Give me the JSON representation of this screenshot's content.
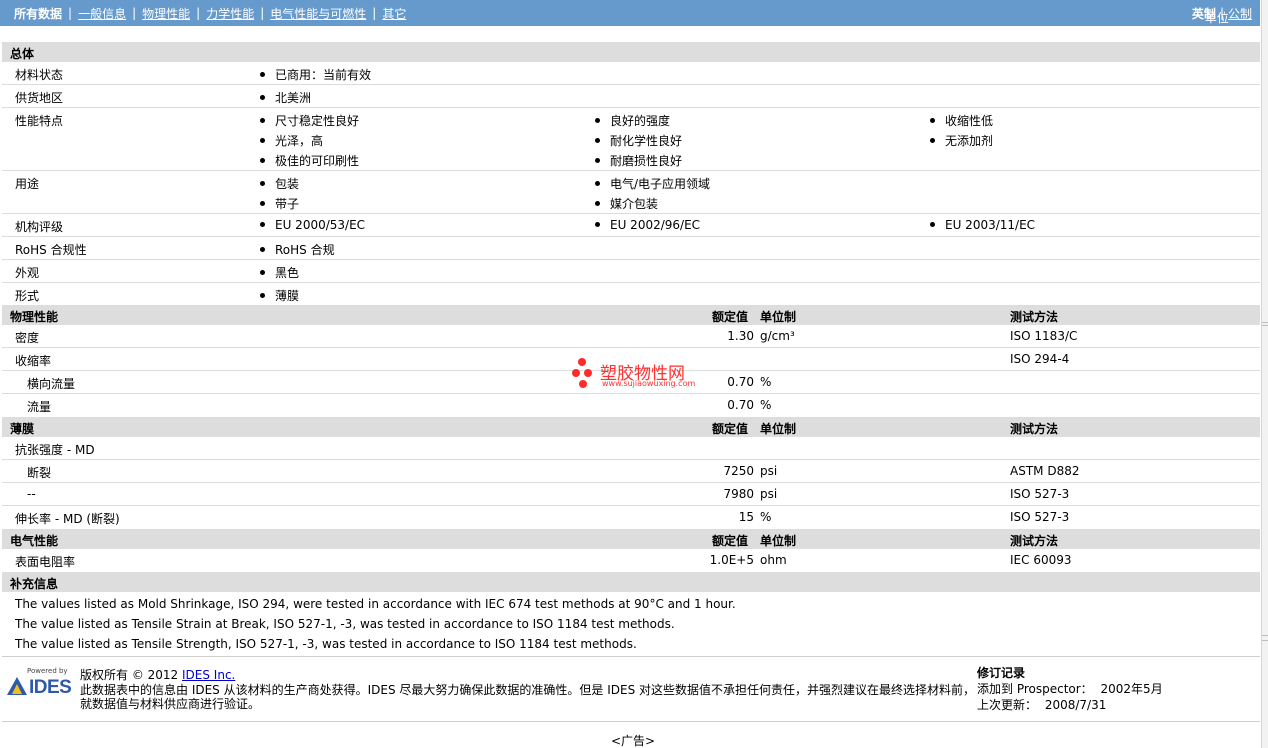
{
  "nav": {
    "all_data": "所有数据",
    "general": "一般信息",
    "physical": "物理性能",
    "mechanical": "力学性能",
    "electrical": "电气性能与可燃性",
    "other": "其它",
    "units_label": "单位",
    "imperial": "英制",
    "metric": "公制",
    "separator": "|"
  },
  "overall": {
    "title": "总体",
    "material_status": {
      "label": "材料状态",
      "items": [
        "已商用：当前有效"
      ]
    },
    "availability": {
      "label": "供货地区",
      "items": [
        "北美洲"
      ]
    },
    "features": {
      "label": "性能特点",
      "items": [
        "尺寸稳定性良好",
        "良好的强度",
        "收缩性低",
        "光泽，高",
        "耐化学性良好",
        "无添加剂",
        "极佳的可印刷性",
        "耐磨损性良好"
      ]
    },
    "uses": {
      "label": "用途",
      "items": [
        "包装",
        "电气/电子应用领域",
        "带子",
        "媒介包装"
      ]
    },
    "agency": {
      "label": "机构评级",
      "items": [
        "EU 2000/53/EC",
        "EU 2002/96/EC",
        "EU 2003/11/EC"
      ]
    },
    "rohs": {
      "label": "RoHS 合规性",
      "items": [
        "RoHS 合规"
      ]
    },
    "appearance": {
      "label": "外观",
      "items": [
        "黑色"
      ]
    },
    "forms": {
      "label": "形式",
      "items": [
        "薄膜"
      ]
    }
  },
  "headers": {
    "nominal": "额定值",
    "unit": "单位制",
    "method": "测试方法"
  },
  "physical": {
    "title": "物理性能",
    "density": {
      "label": "密度",
      "value": "1.30",
      "unit": "g/cm³",
      "method": "ISO 1183/C"
    },
    "shrinkage": {
      "label": "收缩率",
      "method": "ISO 294-4"
    },
    "transverse": {
      "label": "横向流量",
      "value": "0.70",
      "unit": "%"
    },
    "flow": {
      "label": "流量",
      "value": "0.70",
      "unit": "%"
    }
  },
  "film": {
    "title": "薄膜",
    "tensile": {
      "label": "抗张强度  - MD"
    },
    "break": {
      "label": "断裂",
      "value": "7250",
      "unit": "psi",
      "method": "ASTM D882"
    },
    "dash": {
      "label": "--",
      "value": "7980",
      "unit": "psi",
      "method": "ISO 527-3"
    },
    "elong": {
      "label": "伸长率  - MD (断裂)",
      "value": "15",
      "unit": "%",
      "method": "ISO 527-3"
    }
  },
  "electrical": {
    "title": "电气性能",
    "surface": {
      "label": "表面电阻率",
      "value": "1.0E+5",
      "unit": "ohm",
      "method": "IEC 60093"
    }
  },
  "supplement": {
    "title": "补充信息",
    "notes": [
      "The values listed as Mold Shrinkage, ISO 294, were tested in accordance with IEC 674 test methods at 90°C and 1 hour.",
      "The value listed as Tensile Strain at Break, ISO 527-1, -3, was tested in accordance to ISO 1184 test methods.",
      "The value listed as Tensile Strength, ISO 527-1, -3, was tested in accordance to ISO 1184 test methods."
    ]
  },
  "footer": {
    "powered_by": "Powered by",
    "logo_text": "IDES",
    "copyright": "版权所有 © 2012",
    "ides_link": "IDES Inc.",
    "disclaimer1": "此数据表中的信息由  IDES 从该材料的生产商处获得。IDES 尽最大努力确保此数据的准确性。但是  IDES 对这些数据值不承担任何责任，并强烈建议在最终选择材料前，",
    "disclaimer2": "就数据值与材料供应商进行验证。",
    "rev_title": "修订记录",
    "added_label": "添加到  Prospector：",
    "added_date": "2002年5月",
    "updated_label": "上次更新：",
    "updated_date": "2008/7/31"
  },
  "watermark": {
    "cn": "塑胶物性网",
    "en": "www.sujiaowuxing.com"
  },
  "ad": "<广告>"
}
